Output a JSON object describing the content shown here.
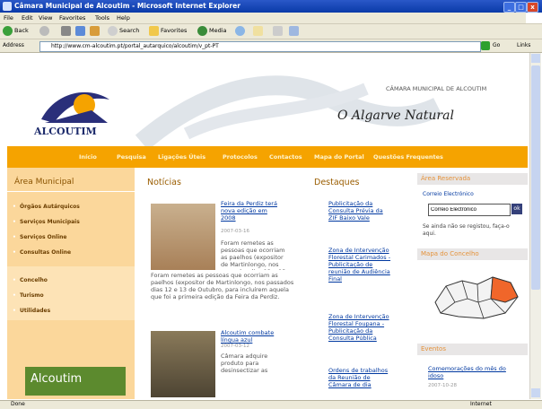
{
  "window": {
    "title": "Câmara Municipal de Alcoutim - Microsoft Internet Explorer",
    "controls": [
      "_",
      "□",
      "x"
    ]
  },
  "menu": [
    "File",
    "Edit",
    "View",
    "Favorites",
    "Tools",
    "Help"
  ],
  "toolbar": {
    "back": "Back",
    "search": "Search",
    "favorites": "Favorites",
    "media": "Media"
  },
  "address": {
    "label": "Address",
    "url": "http://www.cm-alcoutim.pt/portal_autarquico/alcoutim/v_pt-PT",
    "go": "Go",
    "links": "Links"
  },
  "header": {
    "logo_text": "ALCOUTIM",
    "municipality": "CÂMARA MUNICIPAL DE ALCOUTIM",
    "slogan": "O Algarve Natural"
  },
  "nav": [
    "Início",
    "Pesquisa",
    "Ligações Úteis",
    "Protocolos",
    "Contactos",
    "Mapa do Portal",
    "Questões Frequentes"
  ],
  "left": {
    "title": "Área Municipal",
    "items_top": [
      "Órgãos Autárquicos",
      "Serviços Municipais",
      "Serviços Online",
      "Consultas Online"
    ],
    "items_bottom": [
      "Concelho",
      "Turismo",
      "Utilidades"
    ],
    "banner": "Alcoutim"
  },
  "news": {
    "title": "Notícias",
    "items": [
      {
        "headline": "Feira da Perdiz terá nova edição em 2008",
        "date": "2007-03-16",
        "text": "Foram remetes as pessoas que ocorriam as paelhos (expositor de Martinlongo, nos passados dias 12 e 13 de Outubro, para incluírem aquela que foi a primeira edição da Feira da Perdiz."
      },
      {
        "headline": "Alcoutim combate língua azul",
        "date": "2007-03-12",
        "text": "Câmara adquire produto para desinsectizar as"
      }
    ]
  },
  "highlights": {
    "title": "Destaques",
    "items": [
      "Publicitação da Consulta Prévia da ZIF Baixo Vale",
      "Zona de Intervenção Florestal Carimados - Publicitação de reunião de Audiência Final",
      "Zona de Intervenção Florestal Foupana - Publicitação da Consulta Pública",
      "Ordens de trabalhos da Reunião de Câmara de dia"
    ]
  },
  "right": {
    "reserved_title": "Área Reservada",
    "email_label": "Correio Electrónico",
    "email_value": "Correio Electrónico",
    "login_button": "ok",
    "register_text": "Se ainda não se registou, faça-o aqui.",
    "map_title": "Mapa do Concelho",
    "events_title": "Eventos",
    "event_link": "Comemorações do mês do idoso",
    "event_date": "2007-10-28"
  },
  "status": {
    "left": "Done",
    "zone": "Internet"
  },
  "colors": {
    "orange": "#f5a300",
    "left_bg": "#fbd79b",
    "link": "#0038a0"
  }
}
